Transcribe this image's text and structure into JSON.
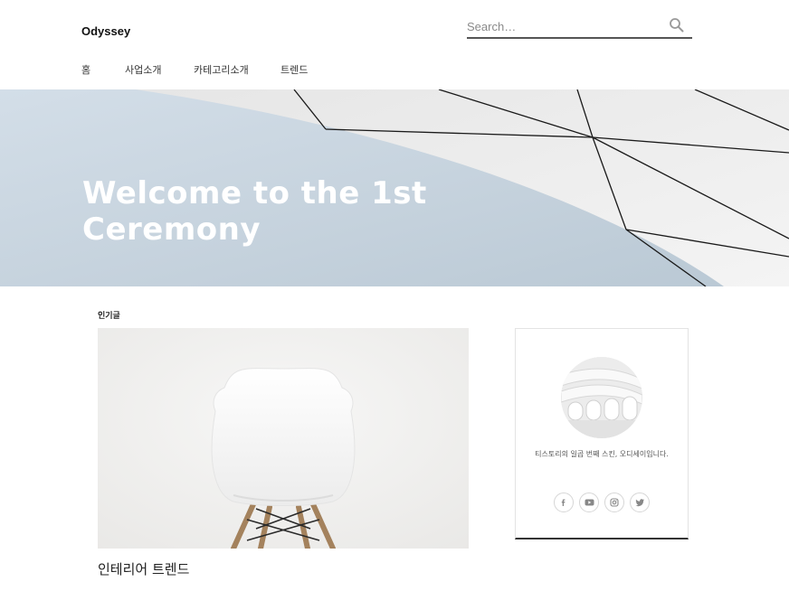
{
  "header": {
    "logo": "Odyssey",
    "search": {
      "placeholder": "Search…",
      "icon": "search-icon"
    }
  },
  "nav": {
    "items": [
      {
        "label": "홈"
      },
      {
        "label": "사업소개"
      },
      {
        "label": "카테고리소개"
      },
      {
        "label": "트렌드"
      }
    ]
  },
  "hero": {
    "title": "Welcome to the 1st Ceremony"
  },
  "main": {
    "section_label": "인기글",
    "post": {
      "title": "인테리어 트렌드"
    }
  },
  "sidebar": {
    "profile": {
      "description": "티스토리의 일곱 번째 스킨, 오디세이입니다.",
      "social": [
        {
          "icon": "facebook-icon"
        },
        {
          "icon": "youtube-icon"
        },
        {
          "icon": "instagram-icon"
        },
        {
          "icon": "twitter-icon"
        }
      ]
    }
  },
  "colors": {
    "hero_bg": "#c7d4df",
    "text": "#222222",
    "border_accent": "#333333"
  }
}
